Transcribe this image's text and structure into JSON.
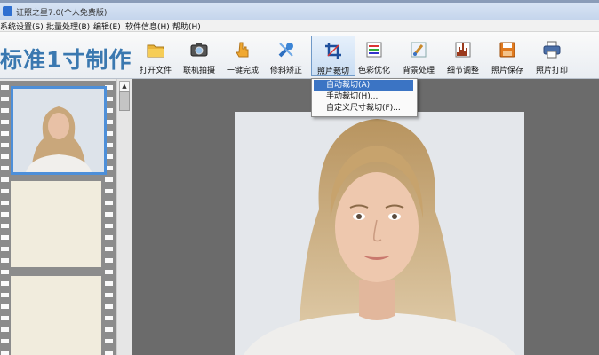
{
  "window": {
    "title": "证照之星7.0(个人免费版)"
  },
  "menu": [
    "系统设置(S)",
    "批量处理(B)",
    "编辑(E)",
    "软件信息(H)",
    "帮助(H)"
  ],
  "brand": "标准1寸制作",
  "toolbar": [
    {
      "label": "打开文件",
      "icon": "folder-icon",
      "active": false
    },
    {
      "label": "联机拍摄",
      "icon": "camera-icon",
      "active": false
    },
    {
      "label": "一键完成",
      "icon": "hand-pointer-icon",
      "active": false
    },
    {
      "label": "修斜矫正",
      "icon": "wrench-icon",
      "active": false
    },
    {
      "label": "照片裁切",
      "icon": "crop-icon",
      "active": true
    },
    {
      "label": "色彩优化",
      "icon": "palette-icon",
      "active": false
    },
    {
      "label": "背景处理",
      "icon": "brush-icon",
      "active": false
    },
    {
      "label": "细节调整",
      "icon": "histogram-icon",
      "active": false
    },
    {
      "label": "照片保存",
      "icon": "save-disk-icon",
      "active": false
    },
    {
      "label": "照片打印",
      "icon": "printer-icon",
      "active": false
    }
  ],
  "crop_menu": [
    {
      "label": "自动裁切(A)",
      "highlighted": true
    },
    {
      "label": "手动裁切(H)...",
      "highlighted": false
    },
    {
      "label": "自定义尺寸裁切(F)...",
      "highlighted": false
    }
  ],
  "colors": {
    "brand": "#3a78b0",
    "highlight": "#3b74c4",
    "selection_border": "#4d8fd9"
  }
}
